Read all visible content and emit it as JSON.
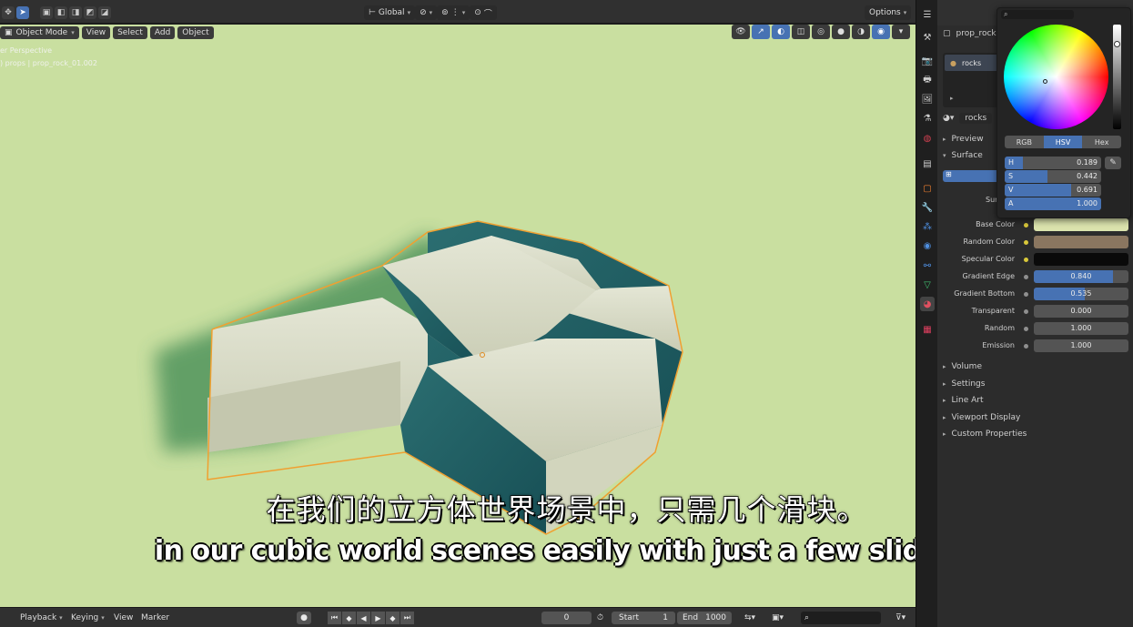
{
  "topbar": {
    "transform_orientation": "Global",
    "options_label": "Options"
  },
  "viewport": {
    "mode_label": "Object Mode",
    "menu": [
      "View",
      "Select",
      "Add",
      "Object"
    ],
    "overlay_line1": "er Perspective",
    "overlay_line2": ") props | prop_rock_01.002"
  },
  "subtitles": {
    "chinese": "在我们的立方体世界场景中，只需几个滑块。",
    "english": "in our cubic world scenes easily with just a few sliders."
  },
  "timeline": {
    "playback": "Playback",
    "keying": "Keying",
    "view": "View",
    "marker": "Marker",
    "current_frame": "0",
    "start_label": "Start",
    "start_value": "1",
    "end_label": "End",
    "end_value": "1000"
  },
  "properties": {
    "object_name": "prop_rock",
    "slot_name": "rocks",
    "material_name": "rocks",
    "preview_label": "Preview",
    "surface_label": "Surface",
    "sur_partial": "Sur",
    "rows": [
      {
        "label": "Base Color",
        "value": "",
        "kind": "color",
        "color": "#dbe3ad",
        "dot": "#d9c83a"
      },
      {
        "label": "Random Color",
        "value": "",
        "kind": "color",
        "color": "#8a7660",
        "dot": "#d9c83a"
      },
      {
        "label": "Specular Color",
        "value": "",
        "kind": "color",
        "color": "#0a0a0a",
        "dot": "#d9c83a"
      },
      {
        "label": "Gradient Edge",
        "value": "0.840",
        "kind": "slider",
        "fraction": 0.84,
        "dot": "#8f8f8f"
      },
      {
        "label": "Gradient Bottom",
        "value": "0.535",
        "kind": "slider",
        "fraction": 0.535,
        "dot": "#8f8f8f"
      },
      {
        "label": "Transparent",
        "value": "0.000",
        "kind": "slider",
        "fraction": 0,
        "dot": "#8f8f8f"
      },
      {
        "label": "Random",
        "value": "1.000",
        "kind": "slider",
        "fraction": 0,
        "dot": "#8f8f8f"
      },
      {
        "label": "Emission",
        "value": "1.000",
        "kind": "slider",
        "fraction": 0,
        "dot": "#8f8f8f"
      }
    ],
    "sections": [
      "Volume",
      "Settings",
      "Line Art",
      "Viewport Display",
      "Custom Properties"
    ]
  },
  "color_picker": {
    "modes": [
      "RGB",
      "HSV",
      "Hex"
    ],
    "active_mode": "HSV",
    "h": {
      "label": "H",
      "value": "0.189",
      "fraction": 0.189
    },
    "s": {
      "label": "S",
      "value": "0.442",
      "fraction": 0.442
    },
    "v": {
      "label": "V",
      "value": "0.691",
      "fraction": 0.691
    },
    "a": {
      "label": "A",
      "value": "1.000",
      "fraction": 1.0
    }
  },
  "colors": {
    "viewport_bg": "#c9dfa0",
    "accent": "#4772b3",
    "rock_light": "#dfe2cf",
    "rock_dark": "#1f5e63",
    "selection_outline": "#f0a030"
  }
}
